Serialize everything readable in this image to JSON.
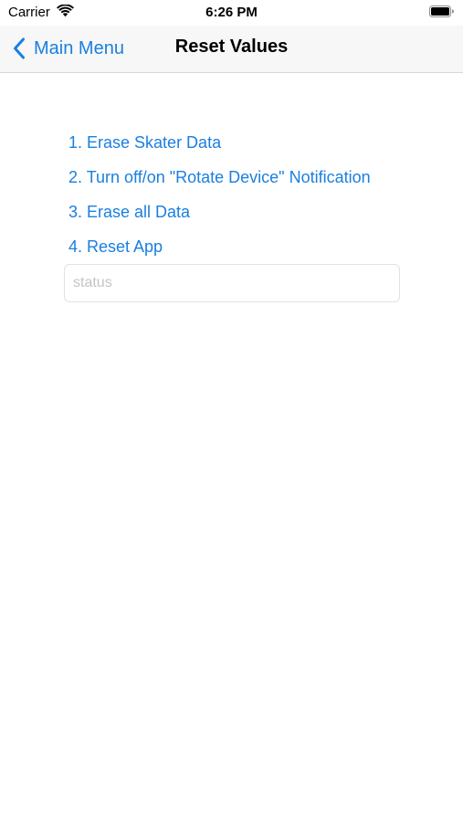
{
  "status_bar": {
    "carrier": "Carrier",
    "time": "6:26 PM",
    "wifi_icon": "wifi-icon",
    "battery_icon": "battery-icon"
  },
  "nav_bar": {
    "back_label": "Main Menu",
    "back_icon": "chevron-left-icon",
    "title": "Reset Values",
    "tint_color": "#1a7fe0"
  },
  "menu": {
    "items": [
      {
        "label": "1. Erase Skater Data"
      },
      {
        "label": "2. Turn off/on \"Rotate Device\" Notification"
      },
      {
        "label": "3. Erase all Data"
      },
      {
        "label": "4. Reset App"
      }
    ]
  },
  "status_field": {
    "value": "",
    "placeholder": "status"
  }
}
